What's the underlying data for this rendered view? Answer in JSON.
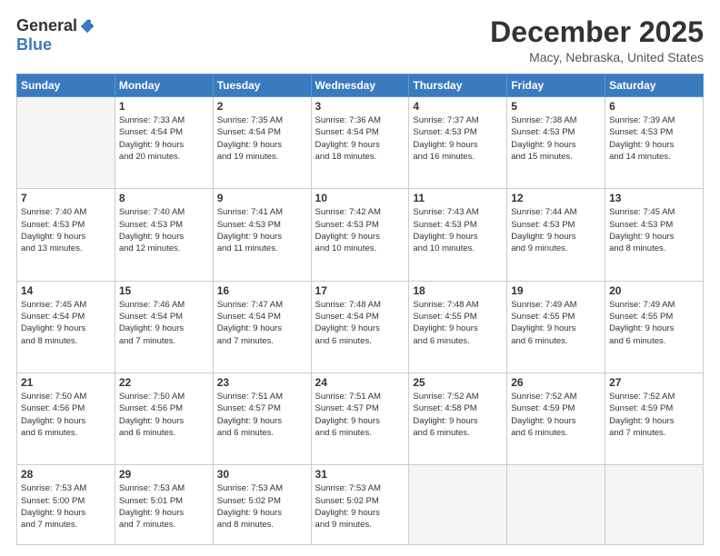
{
  "header": {
    "logo_general": "General",
    "logo_blue": "Blue",
    "month_title": "December 2025",
    "location": "Macy, Nebraska, United States"
  },
  "days_of_week": [
    "Sunday",
    "Monday",
    "Tuesday",
    "Wednesday",
    "Thursday",
    "Friday",
    "Saturday"
  ],
  "weeks": [
    [
      {
        "day": "",
        "info": ""
      },
      {
        "day": "1",
        "info": "Sunrise: 7:33 AM\nSunset: 4:54 PM\nDaylight: 9 hours\nand 20 minutes."
      },
      {
        "day": "2",
        "info": "Sunrise: 7:35 AM\nSunset: 4:54 PM\nDaylight: 9 hours\nand 19 minutes."
      },
      {
        "day": "3",
        "info": "Sunrise: 7:36 AM\nSunset: 4:54 PM\nDaylight: 9 hours\nand 18 minutes."
      },
      {
        "day": "4",
        "info": "Sunrise: 7:37 AM\nSunset: 4:53 PM\nDaylight: 9 hours\nand 16 minutes."
      },
      {
        "day": "5",
        "info": "Sunrise: 7:38 AM\nSunset: 4:53 PM\nDaylight: 9 hours\nand 15 minutes."
      },
      {
        "day": "6",
        "info": "Sunrise: 7:39 AM\nSunset: 4:53 PM\nDaylight: 9 hours\nand 14 minutes."
      }
    ],
    [
      {
        "day": "7",
        "info": "Sunrise: 7:40 AM\nSunset: 4:53 PM\nDaylight: 9 hours\nand 13 minutes."
      },
      {
        "day": "8",
        "info": "Sunrise: 7:40 AM\nSunset: 4:53 PM\nDaylight: 9 hours\nand 12 minutes."
      },
      {
        "day": "9",
        "info": "Sunrise: 7:41 AM\nSunset: 4:53 PM\nDaylight: 9 hours\nand 11 minutes."
      },
      {
        "day": "10",
        "info": "Sunrise: 7:42 AM\nSunset: 4:53 PM\nDaylight: 9 hours\nand 10 minutes."
      },
      {
        "day": "11",
        "info": "Sunrise: 7:43 AM\nSunset: 4:53 PM\nDaylight: 9 hours\nand 10 minutes."
      },
      {
        "day": "12",
        "info": "Sunrise: 7:44 AM\nSunset: 4:53 PM\nDaylight: 9 hours\nand 9 minutes."
      },
      {
        "day": "13",
        "info": "Sunrise: 7:45 AM\nSunset: 4:53 PM\nDaylight: 9 hours\nand 8 minutes."
      }
    ],
    [
      {
        "day": "14",
        "info": "Sunrise: 7:45 AM\nSunset: 4:54 PM\nDaylight: 9 hours\nand 8 minutes."
      },
      {
        "day": "15",
        "info": "Sunrise: 7:46 AM\nSunset: 4:54 PM\nDaylight: 9 hours\nand 7 minutes."
      },
      {
        "day": "16",
        "info": "Sunrise: 7:47 AM\nSunset: 4:54 PM\nDaylight: 9 hours\nand 7 minutes."
      },
      {
        "day": "17",
        "info": "Sunrise: 7:48 AM\nSunset: 4:54 PM\nDaylight: 9 hours\nand 6 minutes."
      },
      {
        "day": "18",
        "info": "Sunrise: 7:48 AM\nSunset: 4:55 PM\nDaylight: 9 hours\nand 6 minutes."
      },
      {
        "day": "19",
        "info": "Sunrise: 7:49 AM\nSunset: 4:55 PM\nDaylight: 9 hours\nand 6 minutes."
      },
      {
        "day": "20",
        "info": "Sunrise: 7:49 AM\nSunset: 4:55 PM\nDaylight: 9 hours\nand 6 minutes."
      }
    ],
    [
      {
        "day": "21",
        "info": "Sunrise: 7:50 AM\nSunset: 4:56 PM\nDaylight: 9 hours\nand 6 minutes."
      },
      {
        "day": "22",
        "info": "Sunrise: 7:50 AM\nSunset: 4:56 PM\nDaylight: 9 hours\nand 6 minutes."
      },
      {
        "day": "23",
        "info": "Sunrise: 7:51 AM\nSunset: 4:57 PM\nDaylight: 9 hours\nand 6 minutes."
      },
      {
        "day": "24",
        "info": "Sunrise: 7:51 AM\nSunset: 4:57 PM\nDaylight: 9 hours\nand 6 minutes."
      },
      {
        "day": "25",
        "info": "Sunrise: 7:52 AM\nSunset: 4:58 PM\nDaylight: 9 hours\nand 6 minutes."
      },
      {
        "day": "26",
        "info": "Sunrise: 7:52 AM\nSunset: 4:59 PM\nDaylight: 9 hours\nand 6 minutes."
      },
      {
        "day": "27",
        "info": "Sunrise: 7:52 AM\nSunset: 4:59 PM\nDaylight: 9 hours\nand 7 minutes."
      }
    ],
    [
      {
        "day": "28",
        "info": "Sunrise: 7:53 AM\nSunset: 5:00 PM\nDaylight: 9 hours\nand 7 minutes."
      },
      {
        "day": "29",
        "info": "Sunrise: 7:53 AM\nSunset: 5:01 PM\nDaylight: 9 hours\nand 7 minutes."
      },
      {
        "day": "30",
        "info": "Sunrise: 7:53 AM\nSunset: 5:02 PM\nDaylight: 9 hours\nand 8 minutes."
      },
      {
        "day": "31",
        "info": "Sunrise: 7:53 AM\nSunset: 5:02 PM\nDaylight: 9 hours\nand 9 minutes."
      },
      {
        "day": "",
        "info": ""
      },
      {
        "day": "",
        "info": ""
      },
      {
        "day": "",
        "info": ""
      }
    ]
  ]
}
